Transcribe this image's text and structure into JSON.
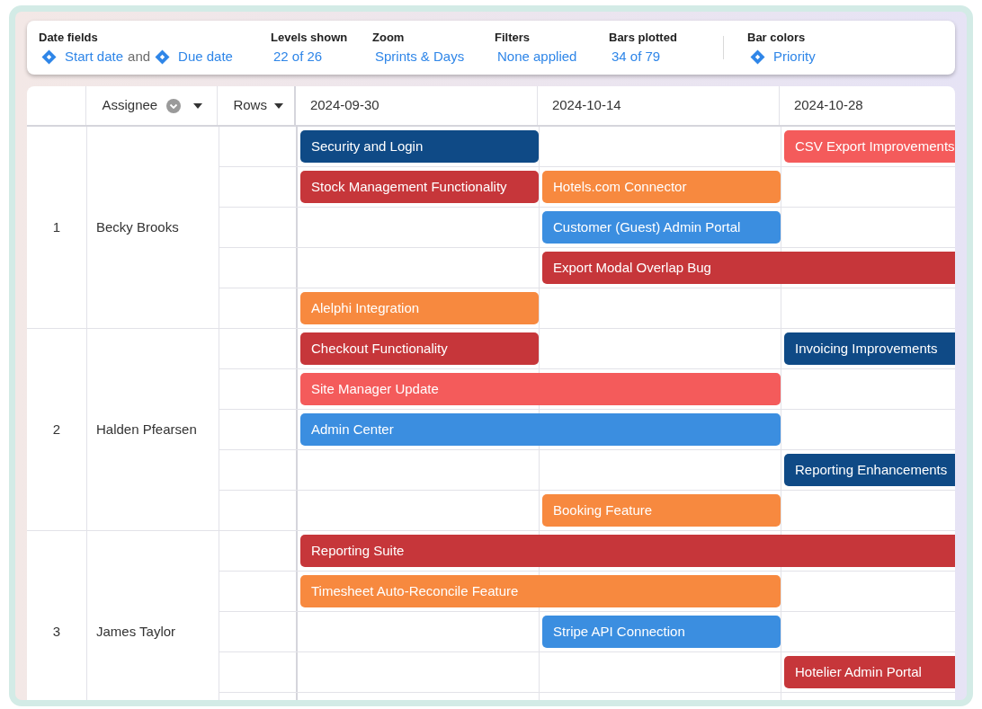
{
  "toolbar": {
    "items": [
      {
        "label": "Date fields",
        "values": [
          {
            "kind": "field",
            "text": "Start date"
          },
          {
            "kind": "plain",
            "text": "and"
          },
          {
            "kind": "field",
            "text": "Due date"
          }
        ]
      },
      {
        "label": "Levels shown",
        "values": [
          {
            "kind": "link",
            "text": "22 of 26"
          }
        ]
      },
      {
        "label": "Zoom",
        "values": [
          {
            "kind": "link",
            "text": "Sprints & Days"
          }
        ]
      },
      {
        "label": "Filters",
        "values": [
          {
            "kind": "link",
            "text": "None applied"
          }
        ]
      },
      {
        "label": "Bars plotted",
        "values": [
          {
            "kind": "link",
            "text": "34 of 79"
          }
        ]
      },
      {
        "label": "Bar colors",
        "values": [
          {
            "kind": "field",
            "text": "Priority"
          }
        ]
      }
    ]
  },
  "table": {
    "columns": [
      {
        "label": "Assignee",
        "kind": "grouped"
      },
      {
        "label": "Rows",
        "kind": "menu"
      }
    ],
    "weeks": [
      "2024-09-30",
      "2024-10-14",
      "2024-10-28"
    ],
    "groups": [
      {
        "index": "1",
        "assignee": "Becky Brooks",
        "lanes": [
          {
            "segments": [
              {
                "kind": "short",
                "label": "Security and Login",
                "color": "#0f4a86"
              },
              {
                "kind": "gap"
              },
              {
                "kind": "open",
                "label": "CSV Export Improvements",
                "color": "#f45b5b"
              }
            ]
          },
          {
            "segments": [
              {
                "kind": "short",
                "label": "Stock Management Functionality",
                "color": "#c6363a"
              },
              {
                "kind": "short",
                "label": "Hotels.com Connector",
                "color": "#f7893f"
              }
            ]
          },
          {
            "segments": [
              {
                "kind": "gap"
              },
              {
                "kind": "short",
                "label": "Customer (Guest) Admin Portal",
                "color": "#3b8ee0"
              }
            ]
          },
          {
            "segments": [
              {
                "kind": "gap"
              },
              {
                "kind": "open",
                "label": "Export Modal Overlap Bug",
                "color": "#c6363a"
              }
            ]
          },
          {
            "segments": [
              {
                "kind": "short",
                "label": "Alelphi Integration",
                "color": "#f7893f"
              }
            ]
          }
        ]
      },
      {
        "index": "2",
        "assignee": "Halden Pfearsen",
        "lanes": [
          {
            "segments": [
              {
                "kind": "short",
                "label": "Checkout Functionality",
                "color": "#c6363a"
              },
              {
                "kind": "gap"
              },
              {
                "kind": "open",
                "label": "Invoicing Improvements",
                "color": "#0f4a86"
              }
            ]
          },
          {
            "segments": [
              {
                "kind": "long",
                "label": "Site Manager Update",
                "color": "#f45b5b"
              }
            ]
          },
          {
            "segments": [
              {
                "kind": "long",
                "label": "Admin Center",
                "color": "#3b8ee0"
              }
            ]
          },
          {
            "segments": [
              {
                "kind": "gap"
              },
              {
                "kind": "gap"
              },
              {
                "kind": "open",
                "label": "Reporting Enhancements",
                "color": "#0f4a86"
              }
            ]
          },
          {
            "segments": [
              {
                "kind": "gap"
              },
              {
                "kind": "short",
                "label": "Booking Feature",
                "color": "#f7893f"
              }
            ]
          }
        ]
      },
      {
        "index": "3",
        "assignee": "James Taylor",
        "lanes": [
          {
            "segments": [
              {
                "kind": "open",
                "label": "Reporting Suite",
                "color": "#c6363a"
              }
            ]
          },
          {
            "segments": [
              {
                "kind": "long",
                "label": "Timesheet Auto-Reconcile Feature",
                "color": "#f7893f"
              }
            ]
          },
          {
            "segments": [
              {
                "kind": "gap"
              },
              {
                "kind": "short",
                "label": "Stripe API Connection",
                "color": "#3b8ee0"
              }
            ]
          },
          {
            "segments": [
              {
                "kind": "gap"
              },
              {
                "kind": "gap"
              },
              {
                "kind": "open",
                "label": "Hotelier Admin Portal",
                "color": "#c6363a"
              }
            ]
          }
        ]
      }
    ]
  }
}
